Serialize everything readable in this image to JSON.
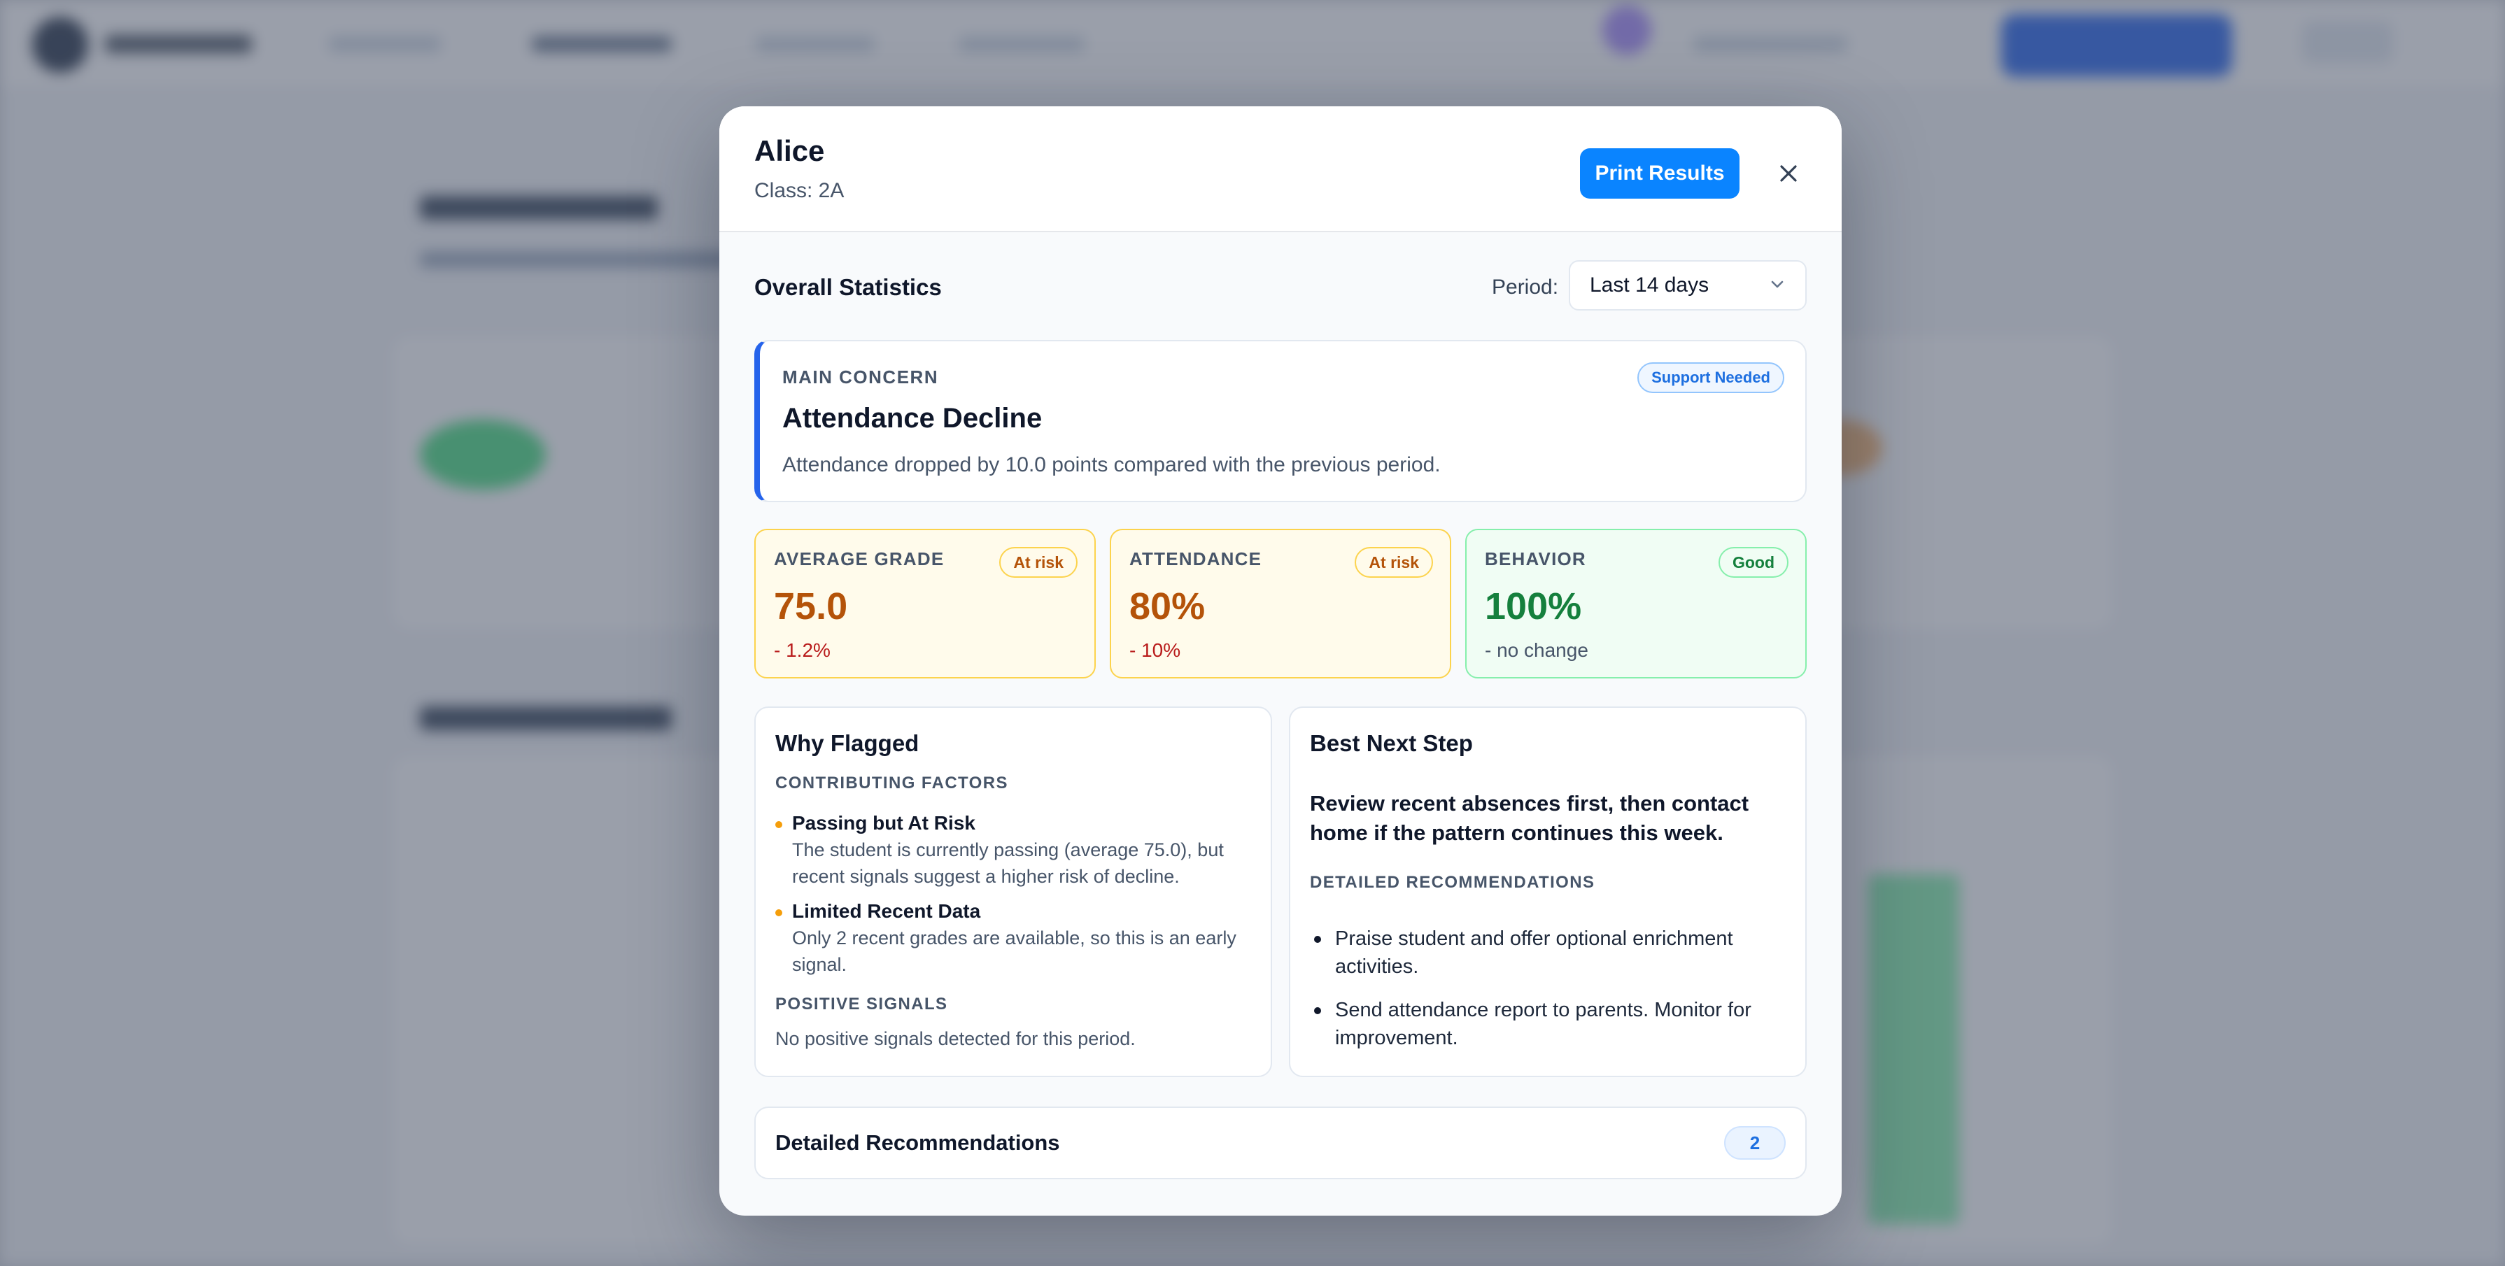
{
  "student": {
    "name": "Alice",
    "class_label": "Class: 2A"
  },
  "header": {
    "print_label": "Print Results",
    "close_icon": "close-icon"
  },
  "overall": {
    "title": "Overall Statistics",
    "period_label": "Period:",
    "period_value": "Last 14 days"
  },
  "concern": {
    "label": "MAIN CONCERN",
    "badge": "Support Needed",
    "title": "Attendance Decline",
    "text": "Attendance dropped by 10.0 points compared with the previous period."
  },
  "metrics": [
    {
      "label": "AVERAGE GRADE",
      "badge": "At risk",
      "value": "75.0",
      "change": "- 1.2%"
    },
    {
      "label": "ATTENDANCE",
      "badge": "At risk",
      "value": "80%",
      "change": "- 10%"
    },
    {
      "label": "BEHAVIOR",
      "badge": "Good",
      "value": "100%",
      "change": "- no change"
    }
  ],
  "why_flagged": {
    "title": "Why Flagged",
    "factors_label": "CONTRIBUTING FACTORS",
    "factors": [
      {
        "title": "Passing but At Risk",
        "lines": [
          "The student is currently passing (average 75.0), but",
          "recent signals suggest a higher risk of decline."
        ]
      },
      {
        "title": "Limited Recent Data",
        "lines": [
          "Only 2 recent grades are available, so this is an early",
          "signal."
        ]
      }
    ],
    "positive_label": "POSITIVE SIGNALS",
    "positive_text": "No positive signals detected for this period."
  },
  "next_step": {
    "title": "Best Next Step",
    "lines": [
      "Review recent absences first, then contact",
      "home if the pattern continues this week."
    ],
    "recs_label": "DETAILED RECOMMENDATIONS",
    "recs": [
      {
        "lines": [
          "Praise student and offer optional enrichment",
          "activities."
        ]
      },
      {
        "lines": [
          "Send attendance report to parents. Monitor for",
          "improvement."
        ]
      }
    ]
  },
  "accordion": {
    "title": "Detailed Recommendations",
    "count": "2"
  },
  "colors": {
    "primary": "#0a84ff",
    "concern_accent": "#2563eb",
    "risk": "#b45309",
    "good": "#15803d",
    "negative_change": "#b91c1c"
  }
}
